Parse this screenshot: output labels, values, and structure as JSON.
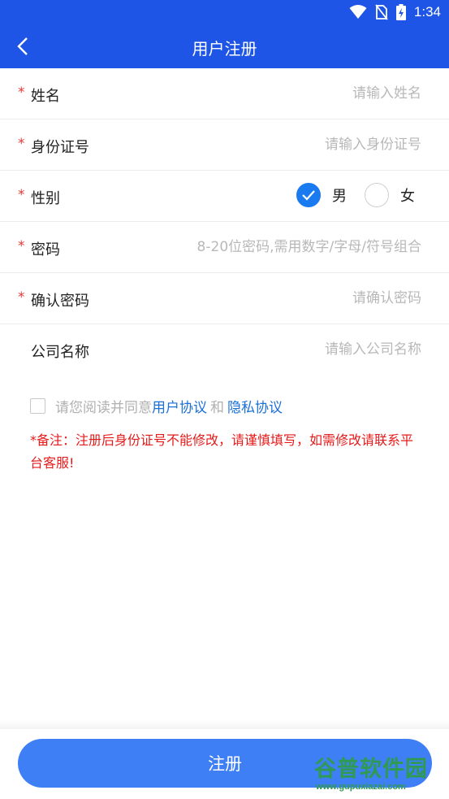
{
  "status_bar": {
    "time": "1:34"
  },
  "app_bar": {
    "title": "用户注册"
  },
  "form": {
    "required_mark": "*",
    "fields": [
      {
        "label": "姓名",
        "placeholder": "请输入姓名",
        "value": ""
      },
      {
        "label": "身份证号",
        "placeholder": "请输入身份证号",
        "value": ""
      },
      {
        "label": "性别"
      },
      {
        "label": "密码",
        "placeholder": "8-20位密码,需用数字/字母/符号组合",
        "value": ""
      },
      {
        "label": "确认密码",
        "placeholder": "请确认密码",
        "value": ""
      },
      {
        "label": "公司名称",
        "placeholder": "请输入公司名称",
        "value": ""
      }
    ],
    "gender_options": [
      {
        "label": "男",
        "selected": true
      },
      {
        "label": "女",
        "selected": false
      }
    ]
  },
  "agreement": {
    "checked": false,
    "prefix": "请您阅读并同意",
    "user_agreement": "用户协议",
    "conjunction": "和",
    "privacy_agreement": "隐私协议"
  },
  "note": "*备注：注册后身份证号不能修改，请谨慎填写，如需修改请联系平台客服!",
  "submit_label": "注册",
  "watermark": {
    "brand": "谷普软件园",
    "url": "www.gupuxiazai.com"
  },
  "colors": {
    "primary": "#1f55e6",
    "button": "#3f7ff5",
    "radio_selected": "#1a7af0",
    "required": "#e53935",
    "note": "#e41b1b",
    "link": "#1a6fd8"
  }
}
